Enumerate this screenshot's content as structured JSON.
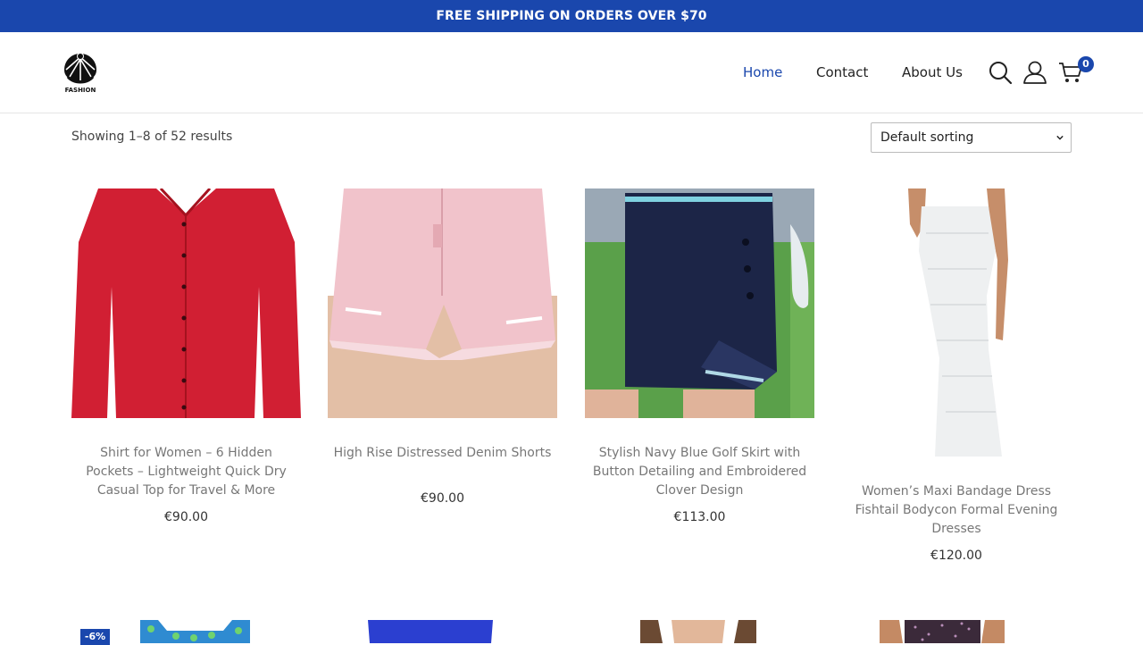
{
  "topbar": {
    "text": "FREE SHIPPING ON ORDERS OVER $70"
  },
  "header": {
    "logo_text": "FASHION",
    "nav": [
      {
        "label": "Home",
        "active": true
      },
      {
        "label": "Contact",
        "active": false
      },
      {
        "label": "About Us",
        "active": false
      }
    ],
    "icons": [
      "search-icon",
      "user-icon",
      "cart-icon"
    ],
    "cart_count": "0"
  },
  "shop": {
    "results_text": "Showing 1–8 of 52 results",
    "sort_selected": "Default sorting"
  },
  "products": [
    {
      "title": "Shirt for Women – 6 Hidden Pockets – Lightweight Quick Dry Casual Top for Travel & More",
      "price": "€90.00"
    },
    {
      "title": "High Rise Distressed Denim Shorts",
      "price": "€90.00"
    },
    {
      "title": "Stylish Navy Blue Golf Skirt with Button Detailing and Embroidered Clover Design",
      "price": "€113.00"
    },
    {
      "title": "Women’s Maxi Bandage Dress Fishtail Bodycon Formal Evening Dresses",
      "price": "€120.00"
    }
  ],
  "second_row": {
    "sale_badge": "-6%"
  },
  "colors": {
    "brand": "#1a47ad",
    "text": "#333333",
    "muted": "#777777"
  }
}
